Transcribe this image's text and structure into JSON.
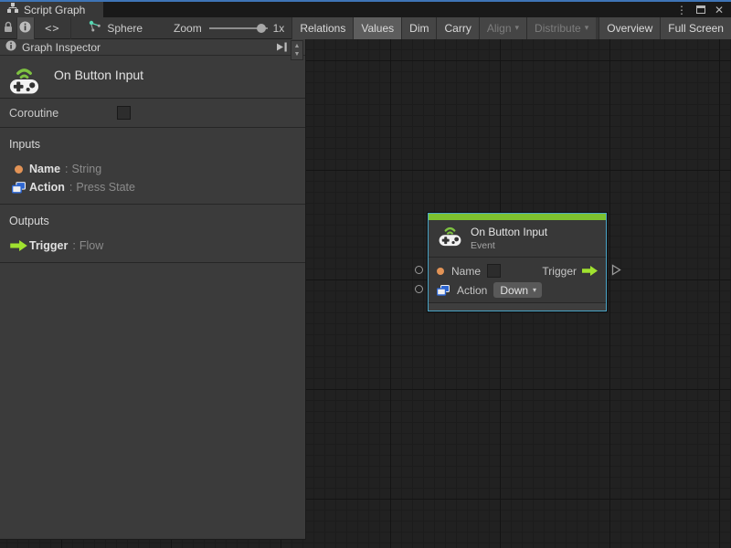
{
  "colors": {
    "focus_blue": "#3e74b6",
    "node_green_bar": "#7cc230",
    "flow_lime": "#a0e22f",
    "value_orange": "#e29356",
    "object_blue": "#2e66d0",
    "selection_teal": "#4ba7c9",
    "canvas_bg": "#212121",
    "panel_bg": "#3b3b3b",
    "sphere_icon_teal": "#56d6b2"
  },
  "strings": {
    "colon": ":"
  },
  "icons": {
    "menu_glyph": "⋮",
    "close_glyph": "✕",
    "code_glyph": "<>",
    "caret_glyph": "▾",
    "up_glyph": "▲",
    "down_glyph": "▼"
  },
  "tab": {
    "title": "Script Graph"
  },
  "toolbar": {
    "target": "Sphere",
    "zoom_label": "Zoom",
    "zoom_value": "1x",
    "buttons": [
      {
        "label": "Relations",
        "state": "normal"
      },
      {
        "label": "Values",
        "state": "active"
      },
      {
        "label": "Dim",
        "state": "normal"
      },
      {
        "label": "Carry",
        "state": "normal"
      },
      {
        "label": "Align",
        "state": "disabled",
        "dropdown": true
      },
      {
        "label": "Distribute",
        "state": "disabled",
        "dropdown": true
      },
      {
        "label": "Overview",
        "state": "normal"
      },
      {
        "label": "Full Screen",
        "state": "normal"
      }
    ]
  },
  "inspector": {
    "header": "Graph Inspector",
    "unit_title": "On Button Input",
    "coroutine_label": "Coroutine",
    "coroutine_checked": false,
    "inputs_title": "Inputs",
    "outputs_title": "Outputs",
    "input_ports": [
      {
        "name": "Name",
        "type": "String",
        "icon": "value-port"
      },
      {
        "name": "Action",
        "type": "Press State",
        "icon": "object-port"
      }
    ],
    "output_ports": [
      {
        "name": "Trigger",
        "type": "Flow",
        "icon": "flow-port"
      }
    ]
  },
  "node": {
    "title": "On Button Input",
    "subtitle": "Event",
    "name_label": "Name",
    "name_value": "",
    "action_label": "Action",
    "action_value": "Down",
    "output_label": "Trigger"
  }
}
